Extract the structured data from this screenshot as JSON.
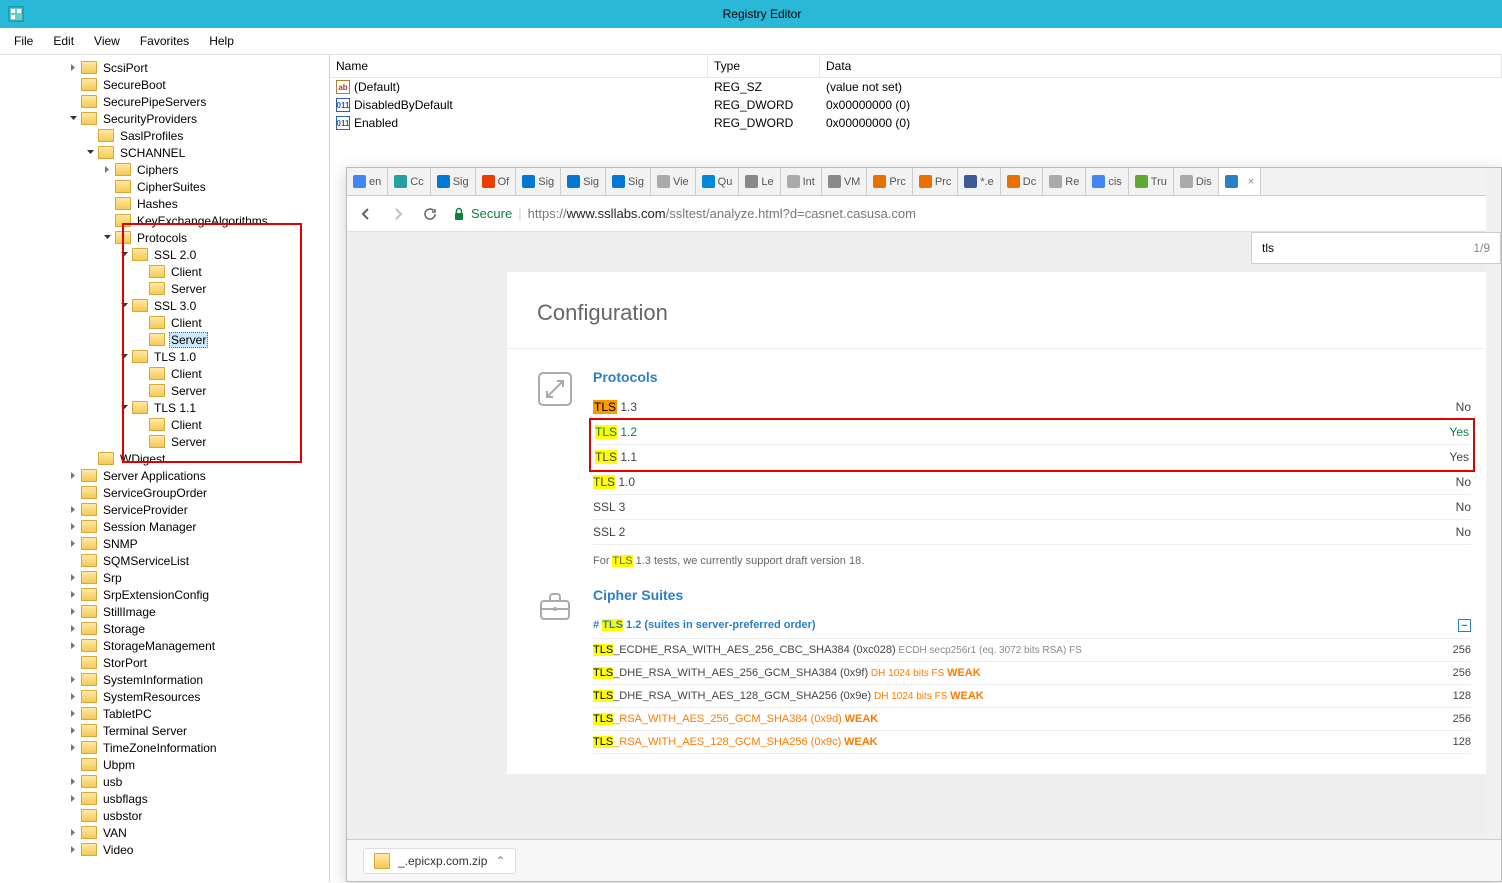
{
  "window": {
    "title": "Registry Editor"
  },
  "menu": [
    "File",
    "Edit",
    "View",
    "Favorites",
    "Help"
  ],
  "tree": [
    {
      "l": 4,
      "t": 1,
      "label": "ScsiPort"
    },
    {
      "l": 4,
      "t": 0,
      "label": "SecureBoot"
    },
    {
      "l": 4,
      "t": 0,
      "label": "SecurePipeServers"
    },
    {
      "l": 4,
      "t": 2,
      "label": "SecurityProviders"
    },
    {
      "l": 5,
      "t": 0,
      "label": "SaslProfiles"
    },
    {
      "l": 5,
      "t": 2,
      "label": "SCHANNEL"
    },
    {
      "l": 6,
      "t": 1,
      "label": "Ciphers"
    },
    {
      "l": 6,
      "t": 0,
      "label": "CipherSuites"
    },
    {
      "l": 6,
      "t": 0,
      "label": "Hashes"
    },
    {
      "l": 6,
      "t": 0,
      "label": "KeyExchangeAlgorithms"
    },
    {
      "l": 6,
      "t": 2,
      "label": "Protocols"
    },
    {
      "l": 7,
      "t": 2,
      "label": "SSL 2.0"
    },
    {
      "l": 8,
      "t": 0,
      "label": "Client"
    },
    {
      "l": 8,
      "t": 0,
      "label": "Server"
    },
    {
      "l": 7,
      "t": 2,
      "label": "SSL 3.0"
    },
    {
      "l": 8,
      "t": 0,
      "label": "Client"
    },
    {
      "l": 8,
      "t": 0,
      "label": "Server",
      "sel": true
    },
    {
      "l": 7,
      "t": 2,
      "label": "TLS 1.0"
    },
    {
      "l": 8,
      "t": 0,
      "label": "Client"
    },
    {
      "l": 8,
      "t": 0,
      "label": "Server"
    },
    {
      "l": 7,
      "t": 2,
      "label": "TLS 1.1"
    },
    {
      "l": 8,
      "t": 0,
      "label": "Client"
    },
    {
      "l": 8,
      "t": 0,
      "label": "Server"
    },
    {
      "l": 5,
      "t": 0,
      "label": "WDigest"
    },
    {
      "l": 4,
      "t": 1,
      "label": "Server Applications"
    },
    {
      "l": 4,
      "t": 0,
      "label": "ServiceGroupOrder"
    },
    {
      "l": 4,
      "t": 1,
      "label": "ServiceProvider"
    },
    {
      "l": 4,
      "t": 1,
      "label": "Session Manager"
    },
    {
      "l": 4,
      "t": 1,
      "label": "SNMP"
    },
    {
      "l": 4,
      "t": 0,
      "label": "SQMServiceList"
    },
    {
      "l": 4,
      "t": 1,
      "label": "Srp"
    },
    {
      "l": 4,
      "t": 1,
      "label": "SrpExtensionConfig"
    },
    {
      "l": 4,
      "t": 1,
      "label": "StillImage"
    },
    {
      "l": 4,
      "t": 1,
      "label": "Storage"
    },
    {
      "l": 4,
      "t": 1,
      "label": "StorageManagement"
    },
    {
      "l": 4,
      "t": 0,
      "label": "StorPort"
    },
    {
      "l": 4,
      "t": 1,
      "label": "SystemInformation"
    },
    {
      "l": 4,
      "t": 1,
      "label": "SystemResources"
    },
    {
      "l": 4,
      "t": 1,
      "label": "TabletPC"
    },
    {
      "l": 4,
      "t": 1,
      "label": "Terminal Server"
    },
    {
      "l": 4,
      "t": 1,
      "label": "TimeZoneInformation"
    },
    {
      "l": 4,
      "t": 0,
      "label": "Ubpm"
    },
    {
      "l": 4,
      "t": 1,
      "label": "usb"
    },
    {
      "l": 4,
      "t": 1,
      "label": "usbflags"
    },
    {
      "l": 4,
      "t": 0,
      "label": "usbstor"
    },
    {
      "l": 4,
      "t": 1,
      "label": "VAN"
    },
    {
      "l": 4,
      "t": 1,
      "label": "Video"
    }
  ],
  "list": {
    "headers": [
      "Name",
      "Type",
      "Data"
    ],
    "rows": [
      {
        "icon": "sz",
        "name": "(Default)",
        "type": "REG_SZ",
        "data": "(value not set)"
      },
      {
        "icon": "dw",
        "name": "DisabledByDefault",
        "type": "REG_DWORD",
        "data": "0x00000000 (0)"
      },
      {
        "icon": "dw",
        "name": "Enabled",
        "type": "REG_DWORD",
        "data": "0x00000000 (0)"
      }
    ]
  },
  "browser": {
    "tabs": [
      {
        "fav": "#4285f4",
        "txt": "en"
      },
      {
        "fav": "#26a0a0",
        "txt": "Cc"
      },
      {
        "fav": "#0078d4",
        "txt": "Sig"
      },
      {
        "fav": "#eb3c00",
        "txt": "Of"
      },
      {
        "fav": "#0078d4",
        "txt": "Sig"
      },
      {
        "fav": "#0078d4",
        "txt": "Sig"
      },
      {
        "fav": "#0078d4",
        "txt": "Sig"
      },
      {
        "fav": "#aaa",
        "txt": "Vie"
      },
      {
        "fav": "#0089d6",
        "txt": "Qu"
      },
      {
        "fav": "#888",
        "txt": "Le"
      },
      {
        "fav": "#aaa",
        "txt": "Int"
      },
      {
        "fav": "#888",
        "txt": "VM"
      },
      {
        "fav": "#e87000",
        "txt": "Prc"
      },
      {
        "fav": "#e87000",
        "txt": "Prc"
      },
      {
        "fav": "#3b5998",
        "txt": "*.e"
      },
      {
        "fav": "#e87000",
        "txt": "Dc"
      },
      {
        "fav": "#aaa",
        "txt": "Re"
      },
      {
        "fav": "#4285f4",
        "txt": "cis"
      },
      {
        "fav": "#5fa832",
        "txt": "Tru"
      },
      {
        "fav": "#aaa",
        "txt": "Dis"
      },
      {
        "fav": "#2a7fc5",
        "txt": "",
        "active": true
      }
    ],
    "secure": "Secure",
    "url_prefix": "https://",
    "url_host": "www.ssllabs.com",
    "url_path": "/ssltest/analyze.html?d=casnet.casusa.com",
    "find_value": "tls",
    "find_count": "1/9",
    "ssl": {
      "title": "Configuration",
      "proto_title": "Protocols",
      "protocols": [
        {
          "pre": "TLS",
          "pre_cls": "hl-orange",
          "post": " 1.3",
          "status": "No",
          "scls": "no"
        },
        {
          "pre": "TLS",
          "pre_cls": "hl-yellow",
          "post": " 1.2",
          "status": "Yes",
          "scls": "yes",
          "boxed": true,
          "name_color": "#0b8043"
        },
        {
          "pre": "TLS",
          "pre_cls": "hl-yellow",
          "post": " 1.1",
          "status": "Yes",
          "scls": "no",
          "boxed": true
        },
        {
          "pre": "TLS",
          "pre_cls": "hl-yellow",
          "post": " 1.0",
          "status": "No",
          "scls": "no"
        },
        {
          "pre": "",
          "pre_cls": "",
          "post": "SSL 3",
          "status": "No",
          "scls": "no"
        },
        {
          "pre": "",
          "pre_cls": "",
          "post": "SSL 2",
          "status": "No",
          "scls": "no"
        }
      ],
      "proto_note_pre": "For ",
      "proto_note_hl": "TLS",
      "proto_note_post": " 1.3 tests, we currently support draft version 18.",
      "cipher_title": "Cipher Suites",
      "cipher_heading_pre": "# ",
      "cipher_heading_hl": "TLS",
      "cipher_heading_post": " 1.2 (suites in server-preferred order)",
      "ciphers": [
        {
          "pre": "TLS",
          "cls": "hl-yellow",
          "rest": "_ECDHE_RSA_WITH_AES_256_CBC_SHA384 (0xc028)",
          "extra": "  ECDH secp256r1 (eq. 3072 bits RSA)   FS",
          "weak": "",
          "bits": "256"
        },
        {
          "pre": "TLS",
          "cls": "hl-yellow",
          "rest": "_DHE_RSA_WITH_AES_256_GCM_SHA384 (0x9f)",
          "extra": "   DH 1024 bits   FS   ",
          "weak": "WEAK",
          "bits": "256"
        },
        {
          "pre": "TLS",
          "cls": "hl-yellow",
          "rest": "_DHE_RSA_WITH_AES_128_GCM_SHA256 (0x9e)",
          "extra": "   DH 1024 bits   FS   ",
          "weak": "WEAK",
          "bits": "128"
        },
        {
          "pre": "TLS",
          "cls": "hl-yellow",
          "rest": "_RSA_WITH_AES_256_GCM_SHA384 (0x9d)",
          "extra": "   ",
          "weak": "WEAK",
          "bits": "256",
          "allweak": true
        },
        {
          "pre": "TLS",
          "cls": "hl-yellow",
          "rest": "_RSA_WITH_AES_128_GCM_SHA256 (0x9c)",
          "extra": "   ",
          "weak": "WEAK",
          "bits": "128",
          "allweak": true
        }
      ]
    },
    "download_file": "_.epicxp.com.zip"
  }
}
